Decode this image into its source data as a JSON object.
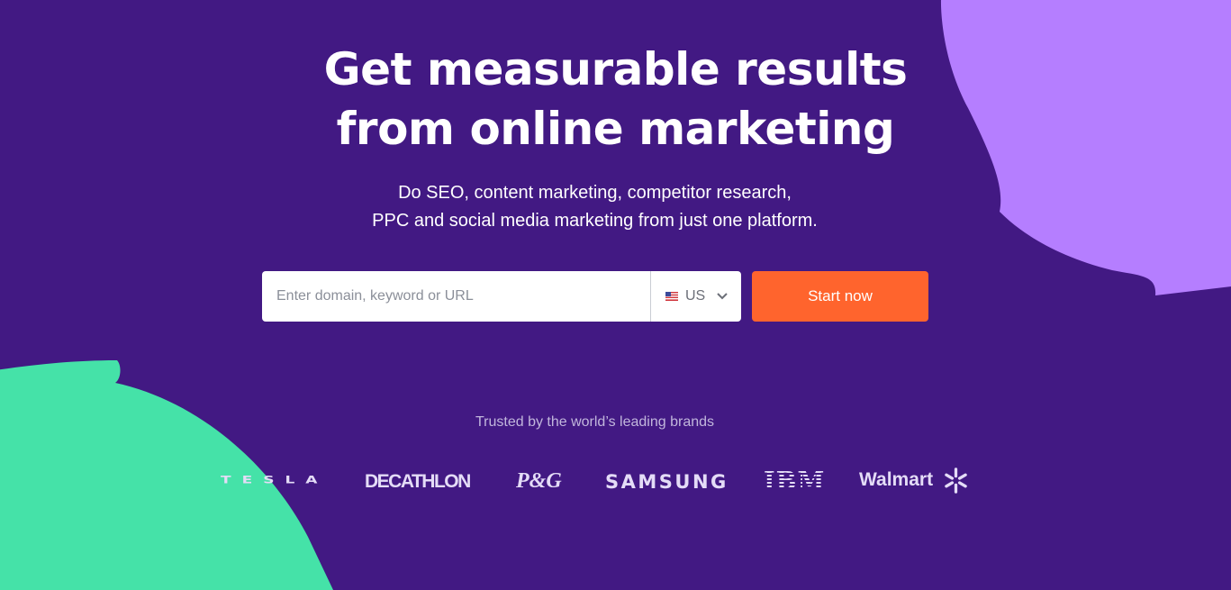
{
  "hero": {
    "headline_line1": "Get measurable results",
    "headline_line2": "from online marketing",
    "subtitle_line1": "Do SEO, content marketing, competitor research,",
    "subtitle_line2": "PPC and social media marketing from just one platform."
  },
  "search": {
    "placeholder": "Enter domain, keyword or URL",
    "value": "",
    "country": "US",
    "submit_label": "Start now"
  },
  "brands": {
    "heading": "Trusted by the world’s leading brands",
    "logos": [
      "TESLA",
      "DECATHLON",
      "P&G",
      "SAMSUNG",
      "IBM",
      "Walmart"
    ]
  },
  "colors": {
    "background": "#421983",
    "accent_purple": "#b57eff",
    "accent_green": "#45e2a8",
    "cta": "#ff642d"
  },
  "icons": [
    "us-flag-icon",
    "chevron-down-icon",
    "walmart-spark-icon"
  ]
}
